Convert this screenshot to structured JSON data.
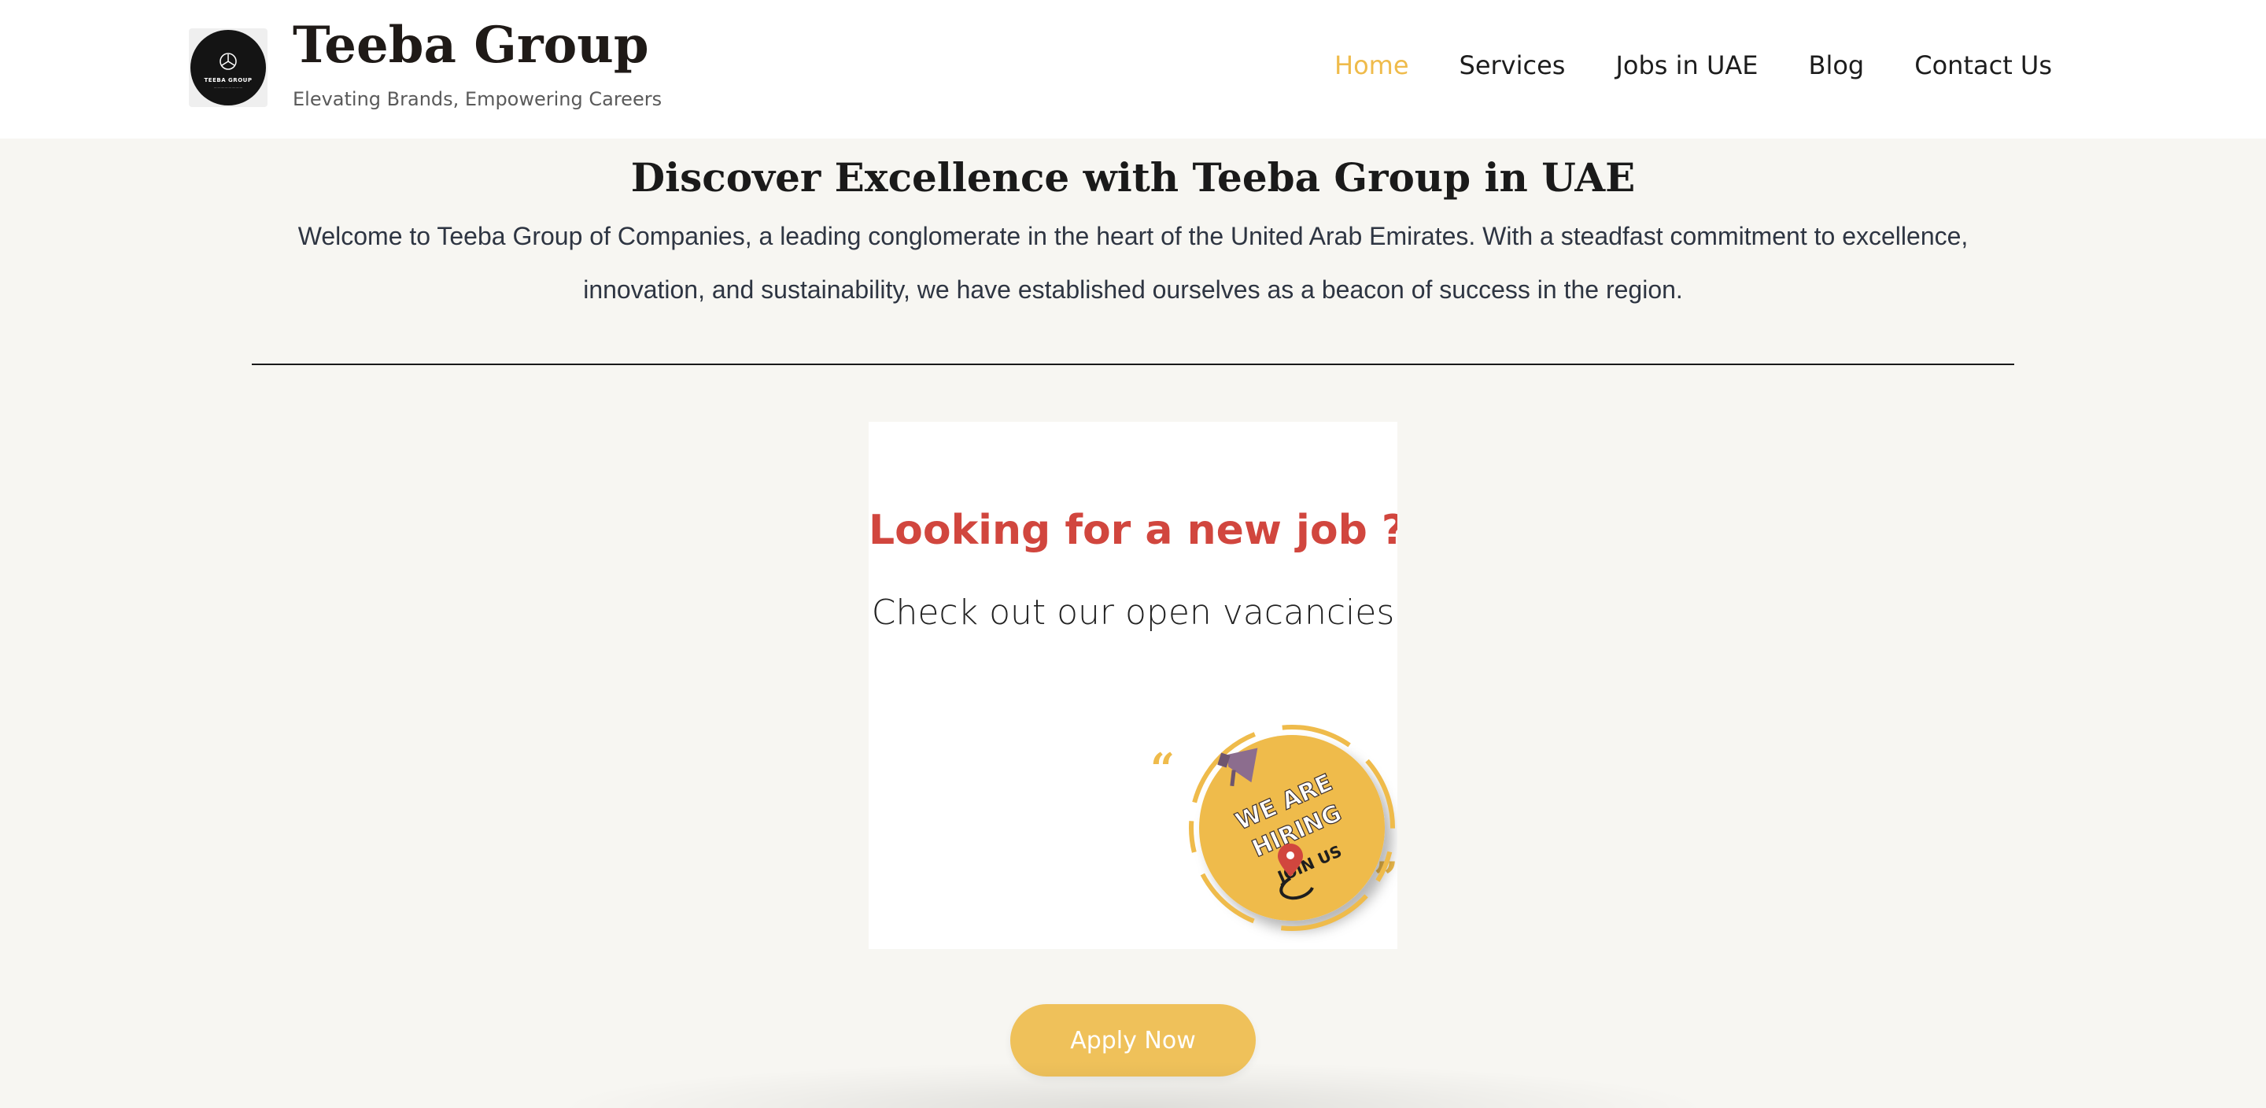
{
  "header": {
    "logo_text": "TEEBA GROUP",
    "brand_title": "Teeba Group",
    "tagline": "Elevating Brands, Empowering Careers",
    "nav": [
      {
        "label": "Home",
        "active": true
      },
      {
        "label": "Services",
        "active": false
      },
      {
        "label": "Jobs in UAE",
        "active": false
      },
      {
        "label": "Blog",
        "active": false
      },
      {
        "label": "Contact Us",
        "active": false
      }
    ]
  },
  "hero": {
    "title": "Discover Excellence with Teeba Group in UAE",
    "text": "Welcome to Teeba Group of Companies, a leading conglomerate in the heart of the United Arab Emirates. With a steadfast commitment to excellence, innovation, and sustainability, we have established ourselves as a beacon of success in the region."
  },
  "banner": {
    "headline": "Looking for a new job ?",
    "subtext": "Check out our open vacancies",
    "badge_line1": "WE ARE",
    "badge_line2": "HIRING",
    "badge_line3": "JOIN US"
  },
  "cta": {
    "apply_label": "Apply Now"
  },
  "colors": {
    "accent": "#efbb4b",
    "button": "#efc15a",
    "headline_red": "#d1463e",
    "page_bg": "#f7f6f2"
  }
}
